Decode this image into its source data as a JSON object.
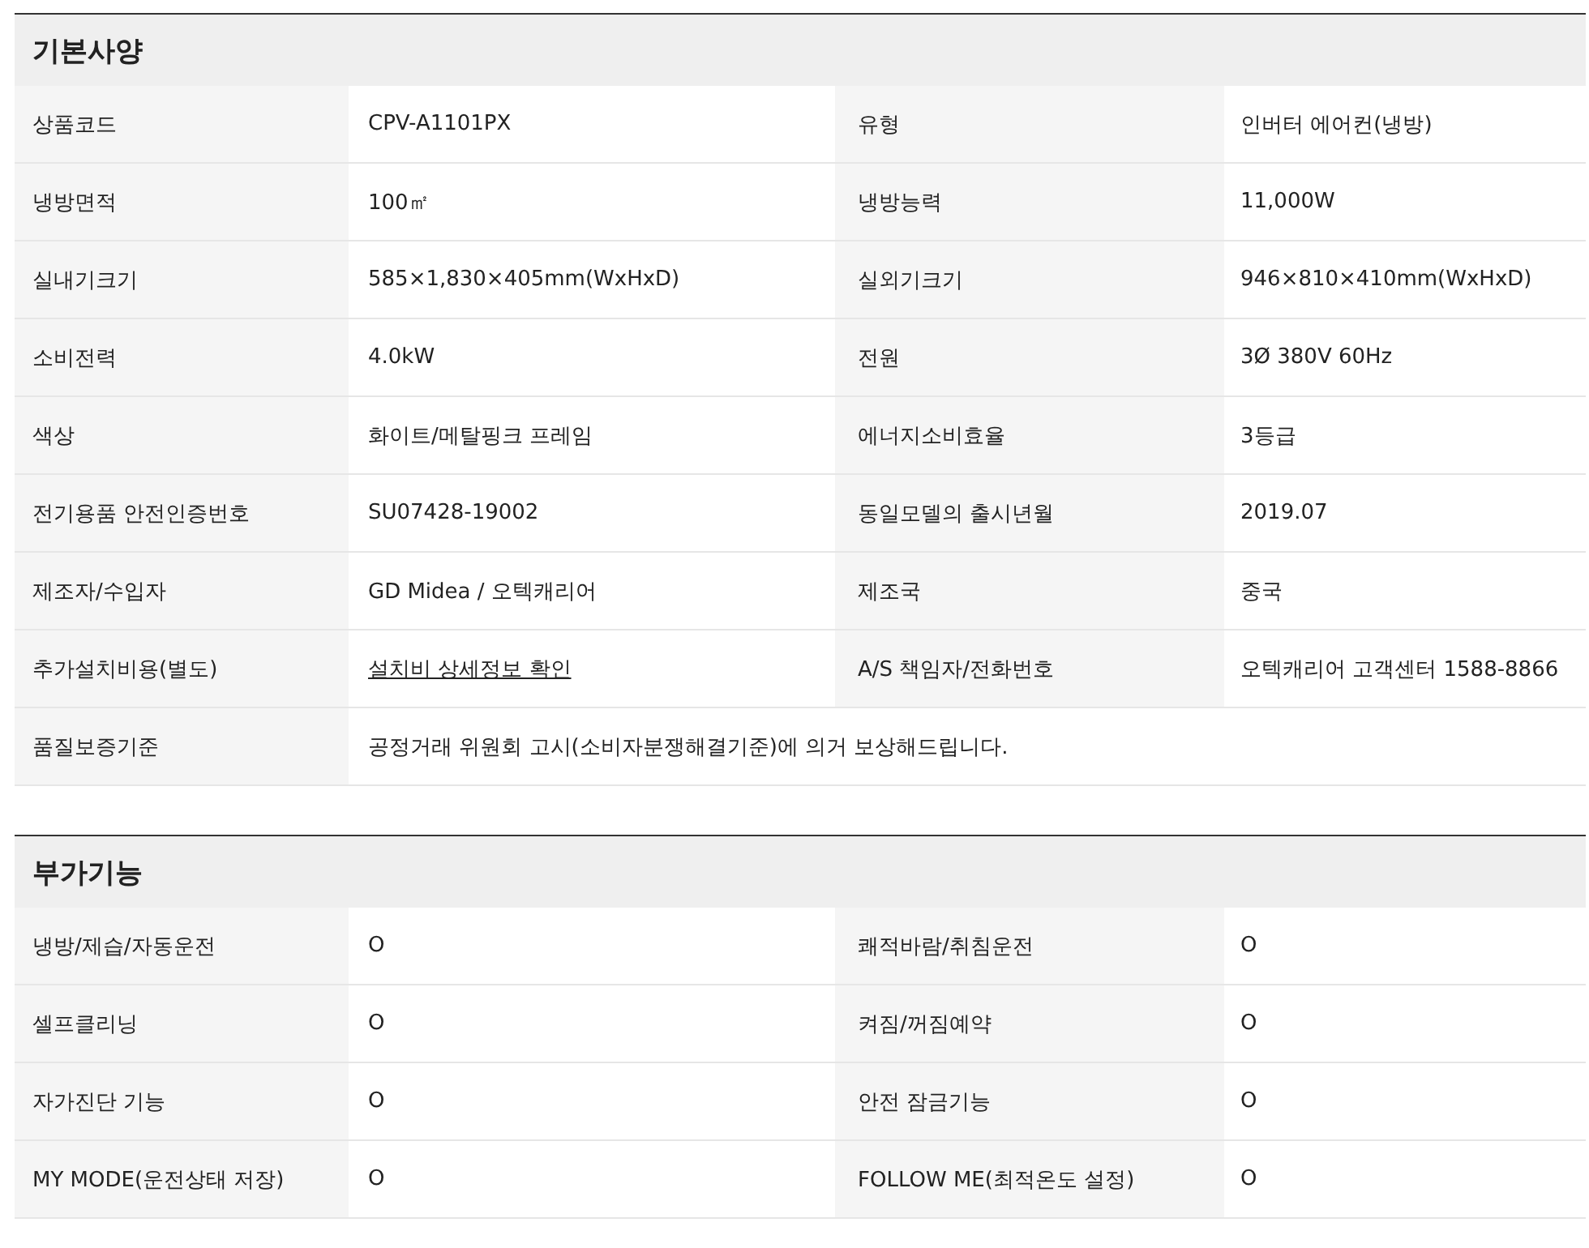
{
  "sections": [
    {
      "title": "기본사양",
      "rows": [
        {
          "pairs": [
            {
              "label": "상품코드",
              "value": "CPV-A1101PX",
              "kind": "text"
            },
            {
              "label": "유형",
              "value": "인버터 에어컨(냉방)",
              "kind": "text"
            }
          ]
        },
        {
          "pairs": [
            {
              "label": "냉방면적",
              "value": "100㎡",
              "kind": "text"
            },
            {
              "label": "냉방능력",
              "value": "11,000W",
              "kind": "text"
            }
          ]
        },
        {
          "pairs": [
            {
              "label": "실내기크기",
              "value": "585×1,830×405mm(WxHxD)",
              "kind": "text"
            },
            {
              "label": "실외기크기",
              "value": "946×810×410mm(WxHxD)",
              "kind": "text"
            }
          ]
        },
        {
          "pairs": [
            {
              "label": "소비전력",
              "value": "4.0kW",
              "kind": "text"
            },
            {
              "label": "전원",
              "value": "3Ø 380V 60Hz",
              "kind": "text"
            }
          ]
        },
        {
          "pairs": [
            {
              "label": "색상",
              "value": "화이트/메탈핑크 프레임",
              "kind": "text"
            },
            {
              "label": "에너지소비효율",
              "value": "3등급",
              "kind": "text"
            }
          ]
        },
        {
          "pairs": [
            {
              "label": "전기용품 안전인증번호",
              "value": "SU07428-19002",
              "kind": "text"
            },
            {
              "label": "동일모델의 출시년월",
              "value": "2019.07",
              "kind": "text"
            }
          ]
        },
        {
          "pairs": [
            {
              "label": "제조자/수입자",
              "value": "GD Midea / 오텍캐리어",
              "kind": "text"
            },
            {
              "label": "제조국",
              "value": "중국",
              "kind": "text"
            }
          ]
        },
        {
          "pairs": [
            {
              "label": "추가설치비용(별도)",
              "value": "설치비 상세정보 확인",
              "kind": "link"
            },
            {
              "label": "A/S 책임자/전화번호",
              "value": "오텍캐리어 고객센터 1588-8866",
              "kind": "text"
            }
          ]
        },
        {
          "pairs": [
            {
              "label": "품질보증기준",
              "value": "공정거래 위원회 고시(소비자분쟁해결기준)에 의거 보상해드립니다.",
              "kind": "text"
            }
          ]
        }
      ]
    },
    {
      "title": "부가기능",
      "rows": [
        {
          "pairs": [
            {
              "label": "냉방/제습/자동운전",
              "value": "O",
              "kind": "text"
            },
            {
              "label": "쾌적바람/취침운전",
              "value": "O",
              "kind": "text"
            }
          ]
        },
        {
          "pairs": [
            {
              "label": "셀프클리닝",
              "value": "O",
              "kind": "text"
            },
            {
              "label": "켜짐/꺼짐예약",
              "value": "O",
              "kind": "text"
            }
          ]
        },
        {
          "pairs": [
            {
              "label": "자가진단 기능",
              "value": "O",
              "kind": "text"
            },
            {
              "label": "안전 잠금기능",
              "value": "O",
              "kind": "text"
            }
          ]
        },
        {
          "pairs": [
            {
              "label": "MY MODE(운전상태 저장)",
              "value": "O",
              "kind": "text"
            },
            {
              "label": "FOLLOW ME(최적온도 설정)",
              "value": "O",
              "kind": "text"
            }
          ]
        }
      ]
    }
  ]
}
